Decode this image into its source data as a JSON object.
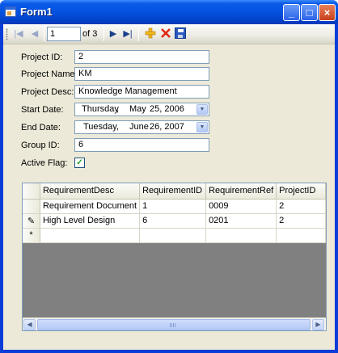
{
  "window": {
    "title": "Form1"
  },
  "titlebar": {
    "minimize": "_",
    "maximize": "□",
    "close": "×"
  },
  "navigator": {
    "position": "1",
    "count_label": "of 3",
    "first_glyph": "|◀",
    "prev_glyph": "◀",
    "next_glyph": "▶",
    "last_glyph": "▶|"
  },
  "form": {
    "project_id_label": "Project ID:",
    "project_id": "2",
    "project_name_label": "Project Name:",
    "project_name": "KM",
    "project_desc_label": "Project Desc:",
    "project_desc": "Knowledge Management",
    "start_date_label": "Start Date:",
    "start_date": {
      "day": "Thursday",
      "sep": ",",
      "month": "May",
      "rest": "25, 2006"
    },
    "end_date_label": "End Date:",
    "end_date": {
      "day": "Tuesday",
      "sep": ",",
      "month": "June",
      "rest": "26, 2007"
    },
    "group_id_label": "Group ID:",
    "group_id": "6",
    "active_flag_label": "Active Flag:",
    "active_flag_checked": true
  },
  "grid": {
    "columns": [
      "RequirementDesc",
      "RequirementID",
      "RequirementRef",
      "ProjectID"
    ],
    "rows": [
      {
        "indicator": "",
        "cells": [
          "Requirement Document",
          "1",
          "0009",
          "2"
        ]
      },
      {
        "indicator": "✎",
        "cells": [
          "High Level Design",
          "6",
          "0201",
          "2"
        ]
      },
      {
        "indicator": "*",
        "cells": [
          "",
          "",
          "",
          ""
        ]
      }
    ]
  },
  "colors": {
    "titlebar": "#0552e0",
    "client": "#ece9d8",
    "grid_background": "#808080"
  }
}
